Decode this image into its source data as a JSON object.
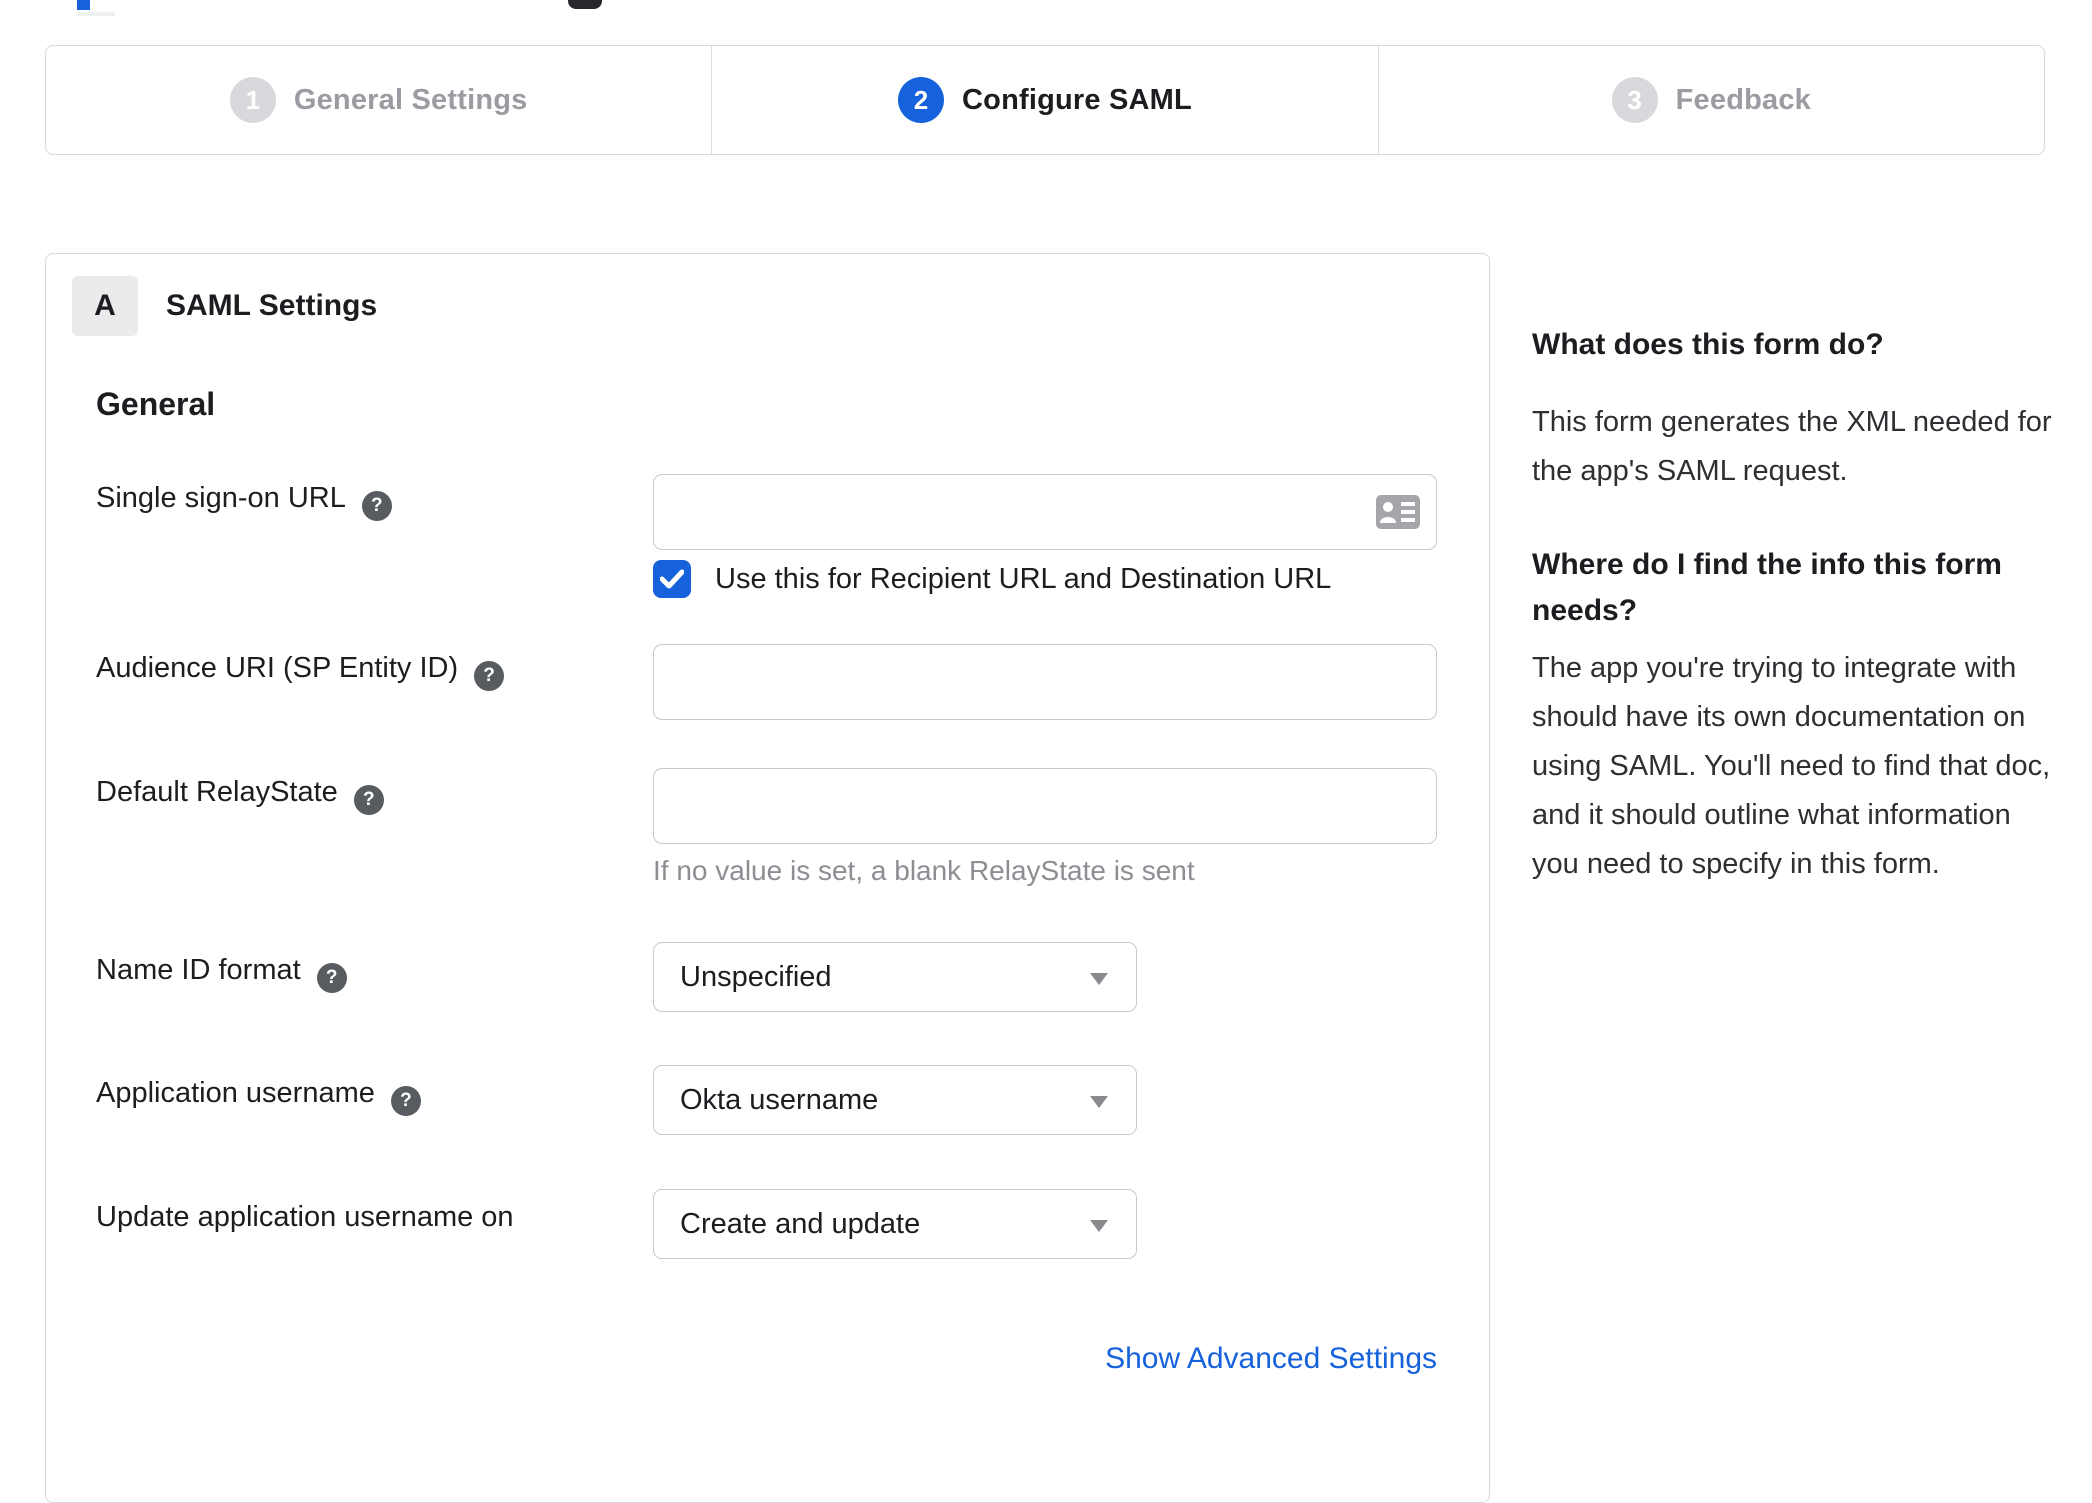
{
  "colors": {
    "accent_blue": "#1662dd",
    "text_dark": "#1d1d21",
    "inactive_gray": "#9b9ba1",
    "hint_gray": "#8d8d93",
    "border_gray": "#d8d8dc"
  },
  "icons": {
    "help": "?"
  },
  "stepper": {
    "steps": [
      {
        "number": "1",
        "label": "General Settings",
        "active": false
      },
      {
        "number": "2",
        "label": "Configure SAML",
        "active": true
      },
      {
        "number": "3",
        "label": "Feedback",
        "active": false
      }
    ]
  },
  "panel": {
    "section_badge": "A",
    "section_title": "SAML Settings",
    "group_heading": "General",
    "form": {
      "sso": {
        "label": "Single sign-on URL",
        "value": "",
        "checkbox_label": "Use this for Recipient URL and Destination URL",
        "checkbox_checked": true
      },
      "audience": {
        "label": "Audience URI (SP Entity ID)",
        "value": ""
      },
      "relay_state": {
        "label": "Default RelayState",
        "value": "",
        "hint": "If no value is set, a blank RelayState is sent"
      },
      "name_id_format": {
        "label": "Name ID format",
        "value": "Unspecified"
      },
      "application_username": {
        "label": "Application username",
        "value": "Okta username"
      },
      "update_application_username": {
        "label": "Update application username on",
        "value": "Create and update"
      }
    },
    "advanced_link_label": "Show Advanced Settings"
  },
  "sidebar": {
    "blocks": [
      {
        "heading": "What does this form do?",
        "body": "This form generates the XML needed for the app's SAML request."
      },
      {
        "heading": "Where do I find the info this form needs?",
        "body": "The app you're trying to integrate with should have its own documentation on using SAML. You'll need to find that doc, and it should outline what information you need to specify in this form."
      }
    ]
  }
}
